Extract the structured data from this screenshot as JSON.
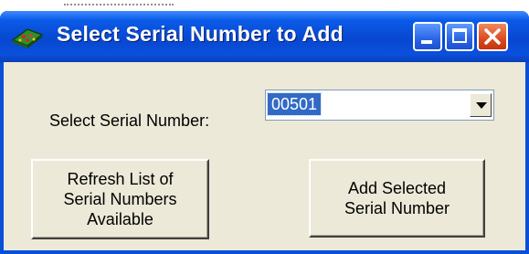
{
  "window": {
    "title": "Select Serial Number to Add",
    "buttons": {
      "minimize": "minimize",
      "maximize": "maximize",
      "close": "close"
    }
  },
  "form": {
    "serial_label": "Select Serial Number:",
    "serial_select": {
      "selected_value": "00501"
    },
    "refresh_button_label": "Refresh List of\nSerial Numbers\nAvailable",
    "add_button_label": "Add Selected\nSerial Number"
  },
  "colors": {
    "titlebar": "#0a50dc",
    "client_bg": "#ece9d8",
    "selection": "#316ac5",
    "close_button": "#dc4a1f"
  },
  "icons": [
    "app-icon",
    "minimize-icon",
    "maximize-icon",
    "close-icon",
    "dropdown-arrow-icon"
  ]
}
